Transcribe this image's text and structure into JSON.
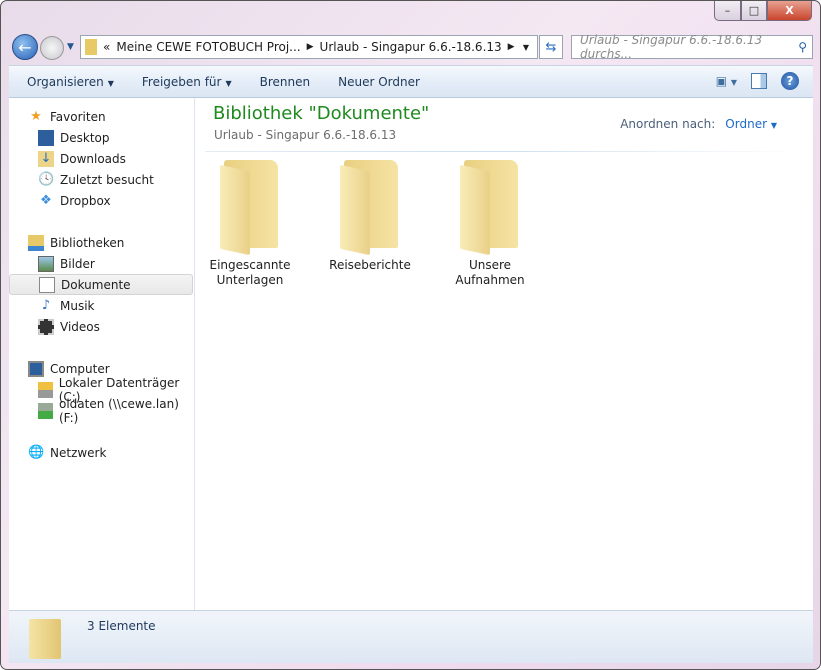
{
  "window": {
    "minimize": "–",
    "maximize": "□",
    "close": "X"
  },
  "address": {
    "overflow": "«",
    "segments": [
      "Meine CEWE FOTOBUCH Proj...",
      "Urlaub - Singapur 6.6.-18.6.13"
    ]
  },
  "search": {
    "placeholder": "Urlaub - Singapur 6.6.-18.6.13 durchs..."
  },
  "toolbar": {
    "organize": "Organisieren",
    "share": "Freigeben für",
    "burn": "Brennen",
    "new_folder": "Neuer Ordner"
  },
  "nav": {
    "favorites": "Favoriten",
    "fav_items": [
      "Desktop",
      "Downloads",
      "Zuletzt besucht",
      "Dropbox"
    ],
    "libraries": "Bibliotheken",
    "lib_items": [
      "Bilder",
      "Dokumente",
      "Musik",
      "Videos"
    ],
    "computer": "Computer",
    "comp_items": [
      "Lokaler Datenträger (C:)",
      "oldaten (\\\\cewe.lan) (F:)"
    ],
    "network": "Netzwerk"
  },
  "content": {
    "title": "Bibliothek \"Dokumente\"",
    "subtitle": "Urlaub - Singapur 6.6.-18.6.13",
    "sort_label": "Anordnen nach:",
    "sort_value": "Ordner",
    "items": [
      [
        "Eingescannte",
        "Unterlagen"
      ],
      [
        "Reiseberichte",
        ""
      ],
      [
        "Unsere",
        "Aufnahmen"
      ]
    ]
  },
  "status": {
    "count": "3 Elemente"
  }
}
